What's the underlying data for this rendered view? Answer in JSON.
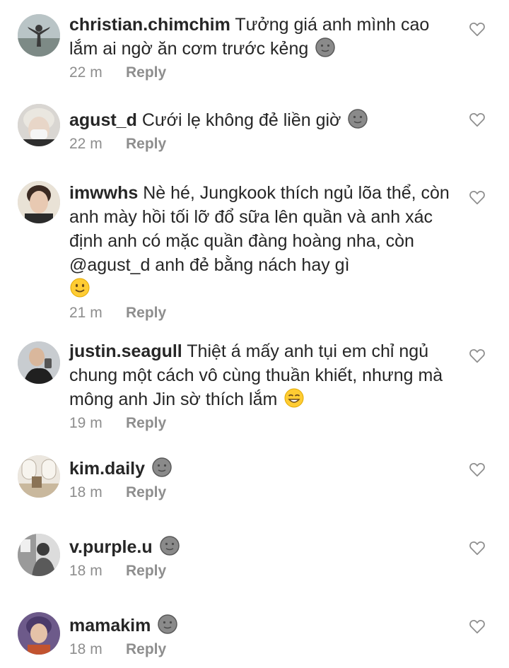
{
  "comments": [
    {
      "username": "christian.chimchim",
      "text": "Tưởng giá anh mình cao lắm ai ngờ ăn cơm trước kẻng",
      "emoji": "moon-face-icon",
      "time": "22 m",
      "reply_label": "Reply"
    },
    {
      "username": "agust_d",
      "text": "Cưới lẹ không đẻ liền giờ",
      "emoji": "moon-face-icon",
      "time": "22 m",
      "reply_label": "Reply"
    },
    {
      "username": "imwwhs",
      "text": "Nè hé, Jungkook thích ngủ lõa thể, còn anh mày hồi tối lỡ đổ sữa lên quần và anh xác định anh có mặc quần đàng hoàng nha, còn @agust_d anh đẻ bằng nách hay gì",
      "emoji": "slightly-smiling-face-icon",
      "time": "21 m",
      "reply_label": "Reply"
    },
    {
      "username": "justin.seagull",
      "text": "Thiệt á mấy anh tụi em chỉ ngủ chung một cách vô cùng thuần khiết, nhưng mà mông anh Jin sờ thích lắm",
      "emoji": "winking-grin-face-icon",
      "time": "19 m",
      "reply_label": "Reply"
    },
    {
      "username": "kim.daily",
      "text": "",
      "emoji": "moon-face-icon",
      "time": "18 m",
      "reply_label": "Reply"
    },
    {
      "username": "v.purple.u",
      "text": "",
      "emoji": "moon-face-icon",
      "time": "18 m",
      "reply_label": "Reply"
    },
    {
      "username": "mamakim",
      "text": "",
      "emoji": "moon-face-icon",
      "time": "18 m",
      "reply_label": "Reply"
    }
  ],
  "colors": {
    "text": "#262626",
    "muted": "#8e8e8e",
    "background": "#ffffff"
  }
}
